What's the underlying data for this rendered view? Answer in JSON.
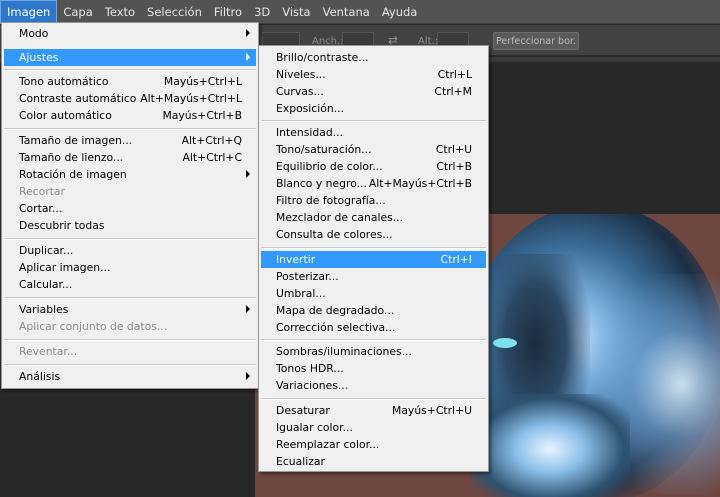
{
  "menubar": {
    "items": [
      "Imagen",
      "Capa",
      "Texto",
      "Selección",
      "Filtro",
      "3D",
      "Vista",
      "Ventana",
      "Ayuda"
    ]
  },
  "options_bar": {
    "width_label": "Anch.:",
    "height_label": "Alt.:",
    "refine_button": "Perfeccionar bor."
  },
  "imagen_menu": [
    {
      "label": "Modo",
      "shortcut": "",
      "submenu": true,
      "disabled": false
    },
    {
      "label": "Ajustes",
      "shortcut": "",
      "submenu": true,
      "disabled": false,
      "highlighted": true
    },
    {
      "label": "Tono automático",
      "shortcut": "Mayús+Ctrl+L",
      "disabled": false
    },
    {
      "label": "Contraste automático",
      "shortcut": "Alt+Mayús+Ctrl+L",
      "disabled": false
    },
    {
      "label": "Color automático",
      "shortcut": "Mayús+Ctrl+B",
      "disabled": false
    },
    {
      "label": "Tamaño de imagen...",
      "shortcut": "Alt+Ctrl+Q",
      "disabled": false
    },
    {
      "label": "Tamaño de lienzo...",
      "shortcut": "Alt+Ctrl+C",
      "disabled": false
    },
    {
      "label": "Rotación de imagen",
      "shortcut": "",
      "submenu": true,
      "disabled": false
    },
    {
      "label": "Recortar",
      "shortcut": "",
      "disabled": true
    },
    {
      "label": "Cortar...",
      "shortcut": "",
      "disabled": false
    },
    {
      "label": "Descubrir todas",
      "shortcut": "",
      "disabled": false
    },
    {
      "label": "Duplicar...",
      "shortcut": "",
      "disabled": false
    },
    {
      "label": "Aplicar imagen...",
      "shortcut": "",
      "disabled": false
    },
    {
      "label": "Calcular...",
      "shortcut": "",
      "disabled": false
    },
    {
      "label": "Variables",
      "shortcut": "",
      "submenu": true,
      "disabled": false
    },
    {
      "label": "Aplicar conjunto de datos...",
      "shortcut": "",
      "disabled": true
    },
    {
      "label": "Reventar...",
      "shortcut": "",
      "disabled": true
    },
    {
      "label": "Análisis",
      "shortcut": "",
      "submenu": true,
      "disabled": false
    }
  ],
  "ajustes_menu": [
    {
      "label": "Brillo/contraste...",
      "shortcut": ""
    },
    {
      "label": "Niveles...",
      "shortcut": "Ctrl+L"
    },
    {
      "label": "Curvas...",
      "shortcut": "Ctrl+M"
    },
    {
      "label": "Exposición...",
      "shortcut": ""
    },
    {
      "label": "Intensidad...",
      "shortcut": ""
    },
    {
      "label": "Tono/saturación...",
      "shortcut": "Ctrl+U"
    },
    {
      "label": "Equilibrio de color...",
      "shortcut": "Ctrl+B"
    },
    {
      "label": "Blanco y negro...",
      "shortcut": "Alt+Mayús+Ctrl+B"
    },
    {
      "label": "Filtro de fotografía...",
      "shortcut": ""
    },
    {
      "label": "Mezclador de canales...",
      "shortcut": ""
    },
    {
      "label": "Consulta de colores...",
      "shortcut": ""
    },
    {
      "label": "Invertir",
      "shortcut": "Ctrl+I",
      "highlighted": true
    },
    {
      "label": "Posterizar...",
      "shortcut": ""
    },
    {
      "label": "Umbral...",
      "shortcut": ""
    },
    {
      "label": "Mapa de degradado...",
      "shortcut": ""
    },
    {
      "label": "Corrección selectiva...",
      "shortcut": ""
    },
    {
      "label": "Sombras/iluminaciones...",
      "shortcut": ""
    },
    {
      "label": "Tonos HDR...",
      "shortcut": ""
    },
    {
      "label": "Variaciones...",
      "shortcut": ""
    },
    {
      "label": "Desaturar",
      "shortcut": "Mayús+Ctrl+U"
    },
    {
      "label": "Igualar color...",
      "shortcut": ""
    },
    {
      "label": "Reemplazar color...",
      "shortcut": ""
    },
    {
      "label": "Ecualizar",
      "shortcut": ""
    }
  ],
  "colors": {
    "menubar_bg": "#535353",
    "menu_bg": "#f0f0f0",
    "highlight": "#3399ff",
    "active_menu": "#2e77c9",
    "canvas_bg": "#6e4741"
  }
}
